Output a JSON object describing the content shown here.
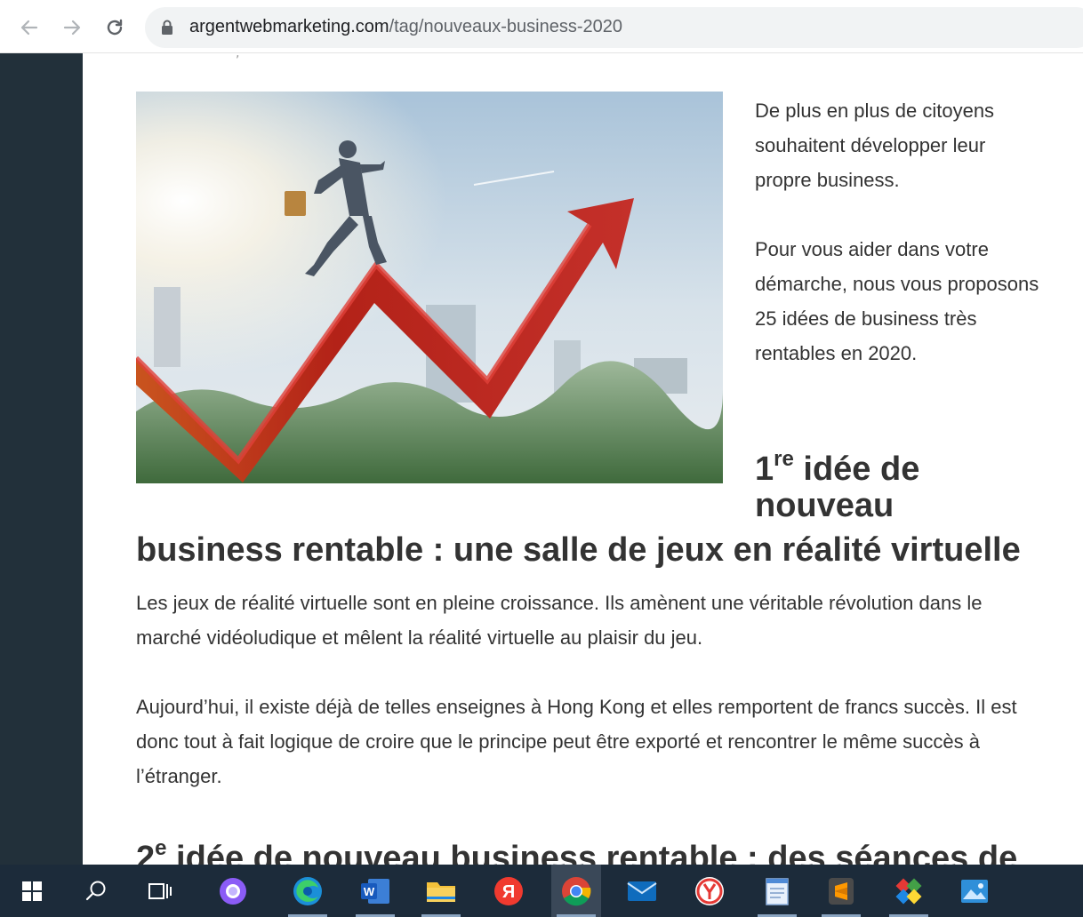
{
  "browser": {
    "url_domain": "argentwebmarketing.com",
    "url_path": "/tag/nouveaux-business-2020"
  },
  "article": {
    "intro_paragraphs": [
      "De plus en plus de citoyens souhaitent développer leur propre business.",
      "Pour vous aider dans votre démarche, nous vous proposons 25 idées de business très rentables en 2020."
    ],
    "heading1_number": "1",
    "heading1_sup": "re",
    "heading1_line1": " idée de",
    "heading1_line2": "nouveau",
    "heading1_line3": "business rentable : une salle de jeux en réalité virtuelle",
    "paragraph1": "Les jeux de réalité virtuelle sont en pleine croissance. Ils amènent une véritable révolution dans le marché vidéoludique et mêlent la réalité virtuelle au plaisir du jeu.",
    "paragraph2": "Aujourd’hui, il existe déjà de telles enseignes à Hong Kong et elles remportent de francs succès. Il est donc tout à fait logique de croire que le principe peut être exporté et rencontrer le même succès à l’étranger.",
    "heading2_number": "2",
    "heading2_sup": "e",
    "heading2_text": " idée de nouveau business rentable : des séances de"
  },
  "taskbar": {
    "items": [
      "windows-start-icon",
      "search-icon",
      "task-view-icon",
      "alice-assistant-icon",
      "edge-browser-icon",
      "word-icon",
      "file-explorer-icon",
      "yandex-icon",
      "chrome-icon",
      "mail-icon",
      "yandex-browser-icon",
      "notepad-icon",
      "sublime-text-icon",
      "paint-tool-icon",
      "photos-icon"
    ],
    "active": "chrome-icon"
  }
}
